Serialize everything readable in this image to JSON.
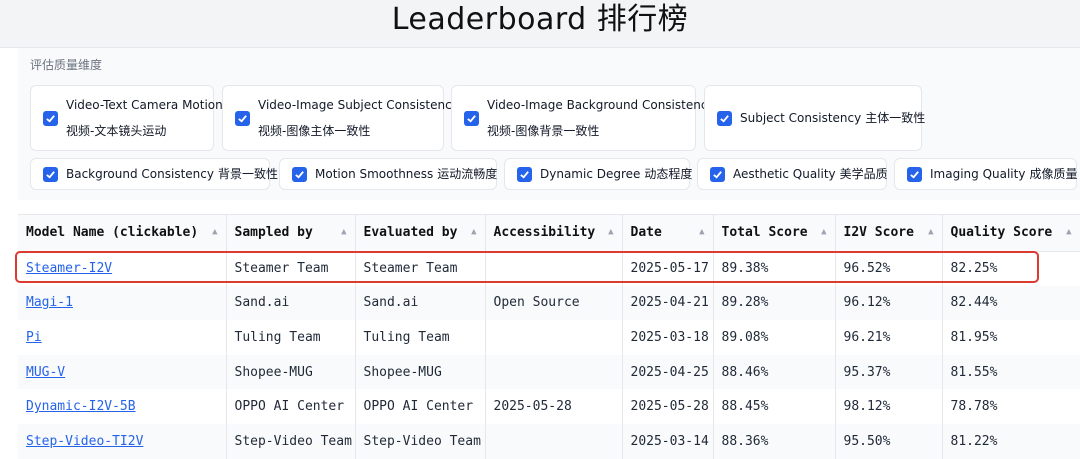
{
  "title": "Leaderboard 排行榜",
  "filters": {
    "label": "评估质量维度",
    "items": [
      {
        "en": "Video-Text Camera Motion",
        "cn": "视频-文本镜头运动",
        "checked": true
      },
      {
        "en": "Video-Image Subject Consistency",
        "cn": "视频-图像主体一致性",
        "checked": true
      },
      {
        "en": "Video-Image Background Consistency",
        "cn": "视频-图像背景一致性",
        "checked": true
      },
      {
        "en": "Subject Consistency",
        "cn": "主体一致性",
        "checked": true
      },
      {
        "en": "Background Consistency",
        "cn": "背景一致性",
        "checked": true
      },
      {
        "en": "Motion Smoothness",
        "cn": "运动流畅度",
        "checked": true
      },
      {
        "en": "Dynamic Degree",
        "cn": "动态程度",
        "checked": true
      },
      {
        "en": "Aesthetic Quality",
        "cn": "美学品质",
        "checked": true
      },
      {
        "en": "Imaging Quality",
        "cn": "成像质量",
        "checked": true
      }
    ]
  },
  "table": {
    "columns": [
      "Model Name (clickable)",
      "Sampled by",
      "Evaluated by",
      "Accessibility",
      "Date",
      "Total Score",
      "I2V Score",
      "Quality Score"
    ],
    "sort_icon": "▲",
    "rows": [
      [
        "Steamer-I2V",
        "Steamer Team",
        "Steamer Team",
        "",
        "2025-05-17",
        "89.38%",
        "96.52%",
        "82.25%"
      ],
      [
        "Magi-1",
        "Sand.ai",
        "Sand.ai",
        "Open Source",
        "2025-04-21",
        "89.28%",
        "96.12%",
        "82.44%"
      ],
      [
        "Pi",
        "Tuling Team",
        "Tuling Team",
        "",
        "2025-03-18",
        "89.08%",
        "96.21%",
        "81.95%"
      ],
      [
        "MUG-V",
        "Shopee-MUG",
        "Shopee-MUG",
        "",
        "2025-04-25",
        "88.46%",
        "95.37%",
        "81.55%"
      ],
      [
        "Dynamic-I2V-5B",
        "OPPO AI Center",
        "OPPO AI Center",
        "2025-05-28",
        "2025-05-28",
        "88.45%",
        "98.12%",
        "78.78%"
      ],
      [
        "Step-Video-TI2V",
        "Step-Video Team",
        "Step-Video Team",
        "",
        "2025-03-14",
        "88.36%",
        "95.50%",
        "81.22%"
      ]
    ],
    "highlighted_row": 0,
    "colors": {
      "link": "#2563eb",
      "highlight": "#dc3b2f",
      "checkbox": "#2563eb"
    }
  }
}
